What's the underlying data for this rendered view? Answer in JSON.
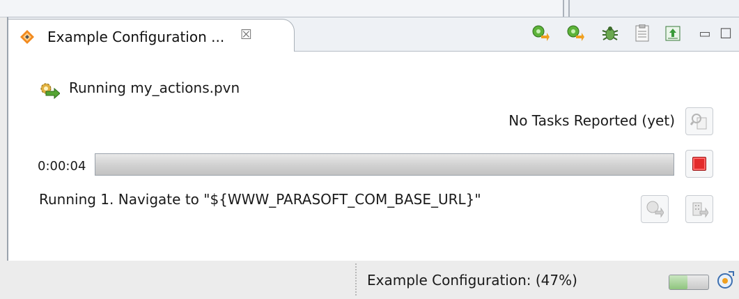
{
  "view": {
    "tab_title": "Example Configuration ...",
    "tab_close_glyph": "☒",
    "tab_icon": "parasoft-diamond-icon",
    "toolbar": {
      "icons": [
        "run-icon",
        "run-alt-icon",
        "debug-icon",
        "report-icon",
        "export-icon"
      ],
      "minimize_glyph": "▭",
      "maximize_glyph": "☐"
    }
  },
  "content": {
    "run_label": "Running my_actions.pvn",
    "tasks_label": "No Tasks Reported (yet)",
    "elapsed_time": "0:00:04",
    "progress_fraction": 1.0,
    "status_text": "Running 1. Navigate to \"${WWW_PARASOFT_COM_BASE_URL}\""
  },
  "statusbar": {
    "label": "Example Configuration: (47%)",
    "progress_percent": 47
  },
  "colors": {
    "stop_red": "#e32b2b",
    "run_green": "#55a534",
    "run_orange": "#f0a020"
  }
}
